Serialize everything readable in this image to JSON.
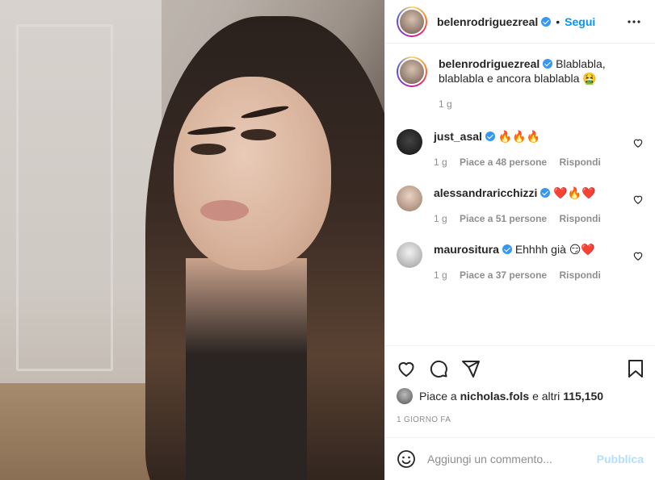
{
  "post": {
    "author": "belenrodriguezreal",
    "follow_label": "Segui",
    "dot": "•",
    "caption": "Blablabla, blablabla e ancora blablabla 🤮",
    "caption_time": "1 g"
  },
  "comments": [
    {
      "user": "just_asal",
      "text": "🔥🔥🔥",
      "time": "1 g",
      "likes": "Piace a 48 persone",
      "reply": "Rispondi"
    },
    {
      "user": "alessandraricchizzi",
      "text": "❤️🔥❤️",
      "time": "1 g",
      "likes": "Piace a 51 persone",
      "reply": "Rispondi"
    },
    {
      "user": "maurositura",
      "text": "Ehhhh già 😏❤️",
      "time": "1 g",
      "likes": "Piace a 37 persone",
      "reply": "Rispondi"
    }
  ],
  "likes": {
    "prefix": "Piace a",
    "user": "nicholas.fols",
    "middle": "e altri",
    "count": "115,150"
  },
  "date": "1 GIORNO FA",
  "add_comment": {
    "placeholder": "Aggiungi un commento...",
    "publish_label": "Pubblica"
  },
  "icons": {
    "more": "more-icon",
    "like": "heart-icon",
    "comment": "comment-icon",
    "share": "share-icon",
    "save": "bookmark-icon",
    "emoji": "emoji-icon"
  },
  "colors": {
    "accent": "#0095f6",
    "verified": "#3897f0",
    "publish_disabled": "#b2dffc",
    "muted": "#8e8e8e"
  }
}
